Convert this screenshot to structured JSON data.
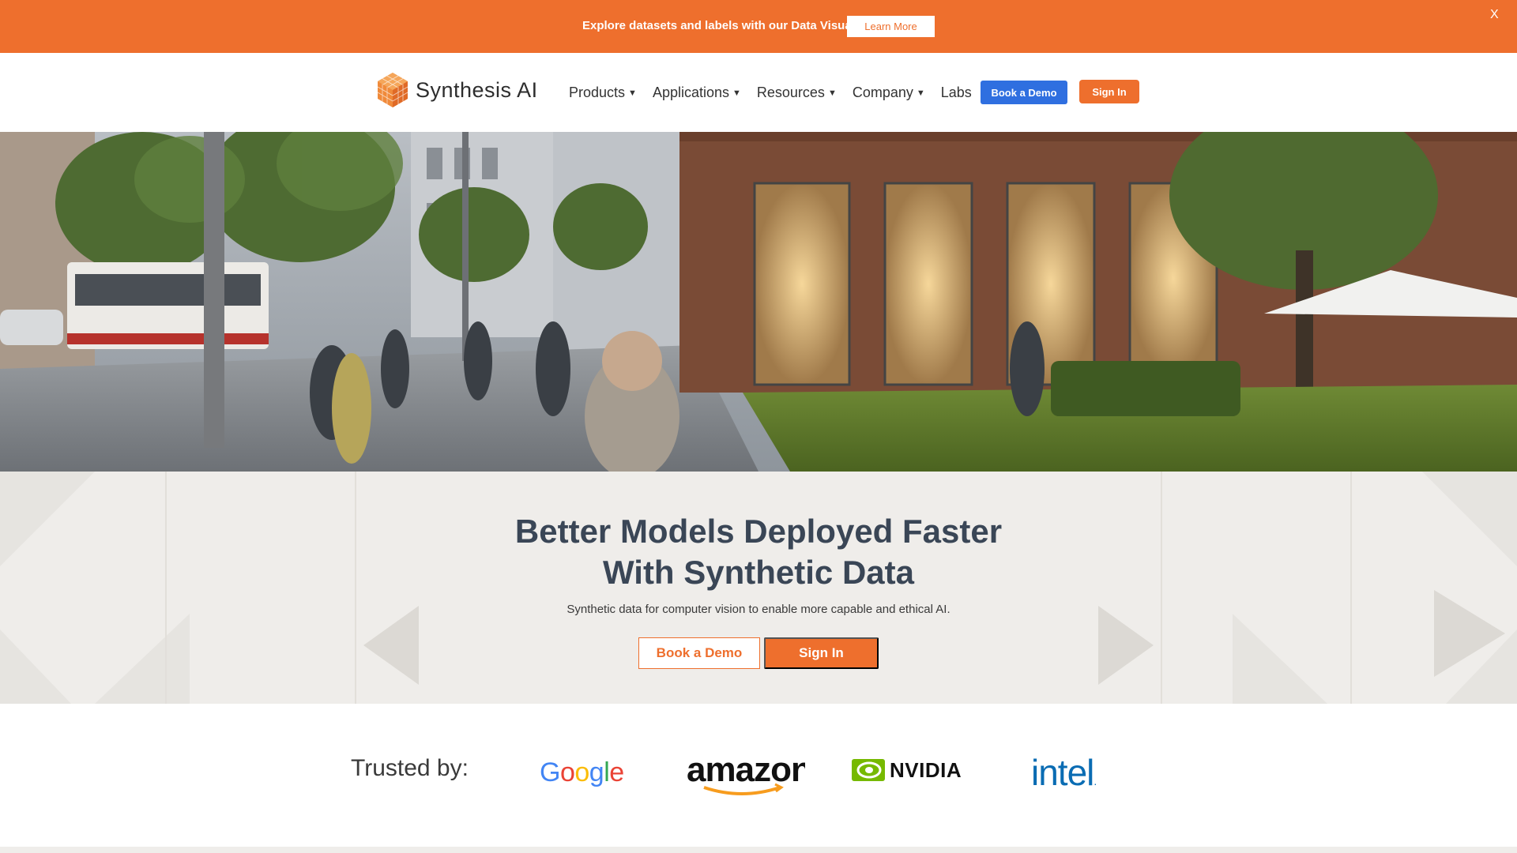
{
  "announcement": {
    "text": "Explore datasets and labels with our Data Visualizer",
    "button_label": "Learn More",
    "close_label": "X",
    "color": "#ee6f2d"
  },
  "header": {
    "logo_text": "Synthesis AI",
    "nav": [
      {
        "label": "Products",
        "has_dropdown": true
      },
      {
        "label": "Applications",
        "has_dropdown": true
      },
      {
        "label": "Resources",
        "has_dropdown": true
      },
      {
        "label": "Company",
        "has_dropdown": true
      },
      {
        "label": "Labs",
        "has_dropdown": false
      }
    ],
    "demo_button": "Book a Demo",
    "signin_button": "Sign In",
    "demo_color": "#2f6fe0",
    "accent_color": "#ee6f2d"
  },
  "hero": {
    "title_line1": "Better Models Deployed Faster",
    "title_line2": "With Synthetic Data",
    "subtitle": "Synthetic data for computer vision to enable more capable and ethical AI.",
    "demo_button": "Book a Demo",
    "signin_button": "Sign In"
  },
  "trusted": {
    "label": "Trusted by:",
    "brands": [
      "Google",
      "amazon",
      "NVIDIA",
      "intel"
    ]
  }
}
